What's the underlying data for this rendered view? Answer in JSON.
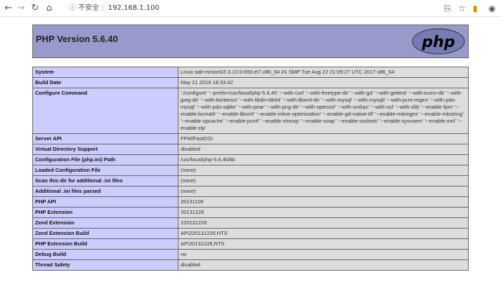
{
  "browser": {
    "back_icon": "arrow-left-icon",
    "forward_icon": "arrow-right-icon",
    "reload_icon": "reload-icon",
    "home_icon": "home-icon",
    "info_icon": "info-icon",
    "insecure_label": "不安全",
    "url": "192.168.1.100",
    "translate_icon": "translate-icon",
    "star_icon": "star-icon",
    "extension_icon": "extension-icon",
    "profile_icon": "profile-icon"
  },
  "php": {
    "title": "PHP Version 5.6.40",
    "logo_text": "php",
    "rows": [
      {
        "label": "System",
        "value": "Linux salt-minion03 3.10.0-693.el7.x86_64 #1 SMP Tue Aug 22 21:09:27 UTC 2017 x86_64"
      },
      {
        "label": "Build Date",
        "value": "May 21 2019 18:33:42"
      },
      {
        "label": "Configure Command",
        "value": "'./configure' '--prefix=/usr/local/php-5.6.40' '--with-curl' '--with-freetype-dir' '--with-gd' '--with-gettext' '--with-iconv-dir' '--with-jpeg-dir' '--with-kerberos' '--with-libdir=lib64' '--with-libxml-dir' '--with-mysql' '--with-mysqli' '--with-pcre-regex' '--with-pdo-mysql' '--with-pdo-sqlite' '--with-pear' '--with-png-dir' '--with-openssl' '--with-xmlrpc' '--with-xsl' '--with-zlib' '--enable-fpm' '--enable-bcmath' '--enable-libxml' '--enable-inline-optimization' '--enable-gd-native-ttf' '--enable-mbregex' '--enable-mbstring' '--enable-opcache' '--enable-pcntl' '--enable-shmop' '--enable-soap' '--enable-sockets' '--enable-sysvsem' '--enable-xml' '--enable-zip'"
      },
      {
        "label": "Server API",
        "value": "FPM/FastCGI"
      },
      {
        "label": "Virtual Directory Support",
        "value": "disabled"
      },
      {
        "label": "Configuration File (php.ini) Path",
        "value": "/usr/local/php-5.6.40/lib"
      },
      {
        "label": "Loaded Configuration File",
        "value": "(none)"
      },
      {
        "label": "Scan this dir for additional .ini files",
        "value": "(none)"
      },
      {
        "label": "Additional .ini files parsed",
        "value": "(none)"
      },
      {
        "label": "PHP API",
        "value": "20131106"
      },
      {
        "label": "PHP Extension",
        "value": "20131226"
      },
      {
        "label": "Zend Extension",
        "value": "220131226"
      },
      {
        "label": "Zend Extension Build",
        "value": "API220131226,NTS"
      },
      {
        "label": "PHP Extension Build",
        "value": "API20131226,NTS"
      },
      {
        "label": "Debug Build",
        "value": "no"
      },
      {
        "label": "Thread Safety",
        "value": "disabled"
      }
    ]
  },
  "colors": {
    "header_bg": "#9999cc",
    "label_bg": "#ccccff",
    "value_bg": "#dddddd",
    "logo_bg": "#777bb4"
  }
}
